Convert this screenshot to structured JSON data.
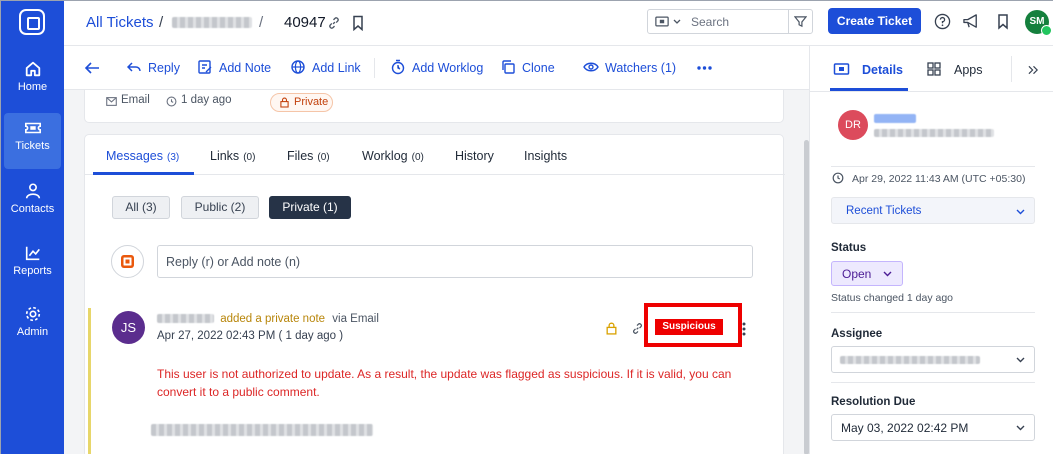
{
  "rail": {
    "items": [
      {
        "label": "Home",
        "icon": "home-icon"
      },
      {
        "label": "Tickets",
        "icon": "ticket-icon"
      },
      {
        "label": "Contacts",
        "icon": "person-icon"
      },
      {
        "label": "Reports",
        "icon": "chart-icon"
      },
      {
        "label": "Admin",
        "icon": "gear-icon"
      }
    ]
  },
  "header": {
    "breadcrumb_link": "All Tickets",
    "breadcrumb_sep": "/",
    "ticket_number": "40947",
    "search_placeholder": "Search",
    "create_button": "Create Ticket",
    "user_initials": "SM"
  },
  "toolbar": {
    "reply": "Reply",
    "add_note": "Add Note",
    "add_link": "Add Link",
    "add_worklog": "Add Worklog",
    "clone": "Clone",
    "watchers": "Watchers (1)"
  },
  "ticket_meta": {
    "channel": "Email",
    "age": "1 day ago",
    "visibility": "Private"
  },
  "tabs": [
    {
      "label": "Messages",
      "count": "(3)"
    },
    {
      "label": "Links",
      "count": "(0)"
    },
    {
      "label": "Files",
      "count": "(0)"
    },
    {
      "label": "Worklog",
      "count": "(0)"
    },
    {
      "label": "History",
      "count": ""
    },
    {
      "label": "Insights",
      "count": ""
    }
  ],
  "filters": {
    "all": "All (3)",
    "public": "Public (2)",
    "private": "Private (1)"
  },
  "reply_placeholder": "Reply (r) or Add note (n)",
  "message": {
    "avatar_initials": "JS",
    "action": "added a private note",
    "via": "via Email",
    "timestamp": "Apr 27, 2022 02:43 PM ( 1 day ago )",
    "badge": "Suspicious",
    "body": "This user is not authorized to update. As a result, the update was flagged as suspicious. If it is valid, you can convert it to a public comment."
  },
  "right_panel": {
    "tab_details": "Details",
    "tab_apps": "Apps",
    "contact_initials": "DR",
    "created": "Apr 29, 2022 11:43 AM (UTC +05:30)",
    "recent_tickets": "Recent Tickets",
    "status_label": "Status",
    "status_value": "Open",
    "status_changed": "Status changed 1 day ago",
    "assignee_label": "Assignee",
    "resolution_label": "Resolution Due",
    "resolution_value": "May 03, 2022 02:42 PM"
  },
  "colors": {
    "brand": "#1d4ed8",
    "suspicious": "#e00000",
    "message_text": "#dc2626"
  }
}
